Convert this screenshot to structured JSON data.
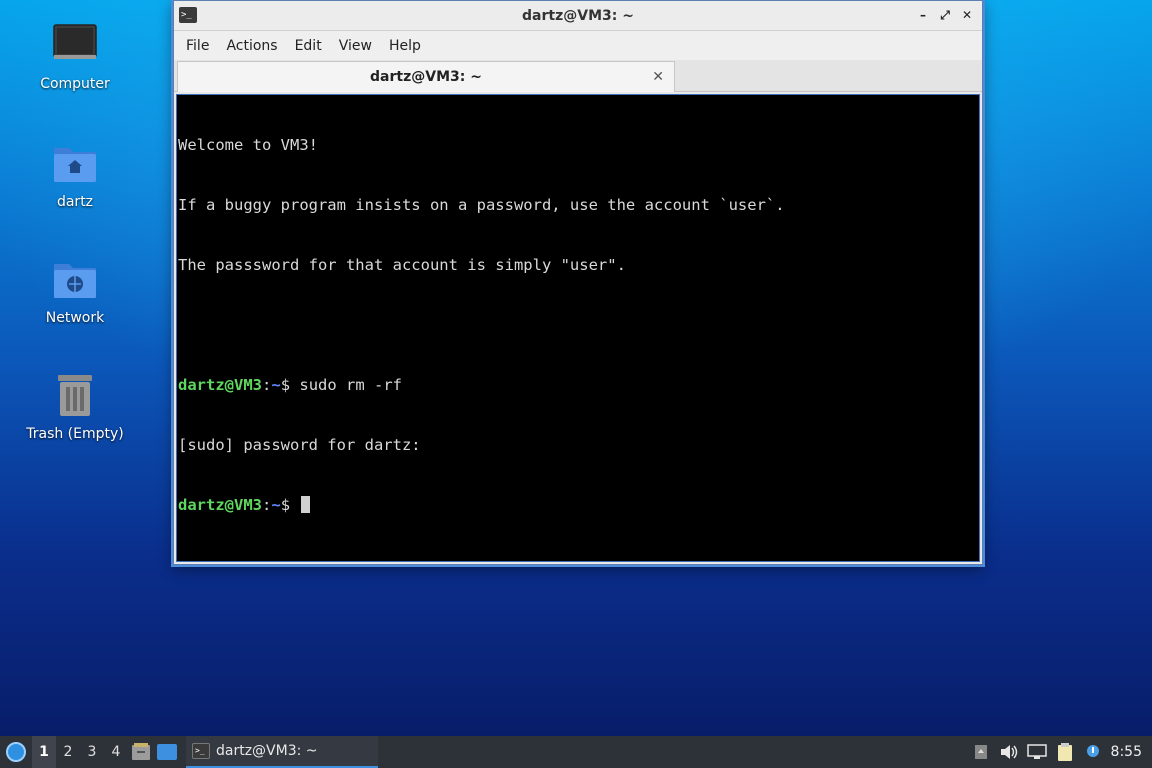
{
  "desktop": {
    "icons": [
      {
        "label": "Computer",
        "icon": "computer-icon"
      },
      {
        "label": "dartz",
        "icon": "home-folder-icon"
      },
      {
        "label": "Network",
        "icon": "network-folder-icon"
      },
      {
        "label": "Trash (Empty)",
        "icon": "trash-icon"
      }
    ]
  },
  "window": {
    "title": "dartz@VM3: ~",
    "controls": {
      "minimize": "–",
      "maximize": "⤢",
      "close": "✕"
    },
    "menu": [
      "File",
      "Actions",
      "Edit",
      "View",
      "Help"
    ],
    "tab": {
      "label": "dartz@VM3: ~",
      "close": "✕"
    }
  },
  "terminal": {
    "lines": [
      "Welcome to VM3!",
      "If a buggy program insists on a password, use the account `user`.",
      "The passsword for that account is simply \"user\".",
      ""
    ],
    "prompt_user": "dartz@VM3",
    "prompt_sep": ":",
    "prompt_path": "~",
    "prompt_symbol": "$ ",
    "command": "sudo rm -rf",
    "sudo_prompt": "[sudo] password for dartz:"
  },
  "taskbar": {
    "workspaces": [
      "1",
      "2",
      "3",
      "4"
    ],
    "active_workspace": "1",
    "task_label": "dartz@VM3: ~",
    "clock": "8:55"
  },
  "colors": {
    "prompt_user": "#5fd75f",
    "prompt_path": "#5f87ff",
    "taskbar_bg": "#2d3138",
    "accent": "#3d8fe0"
  }
}
